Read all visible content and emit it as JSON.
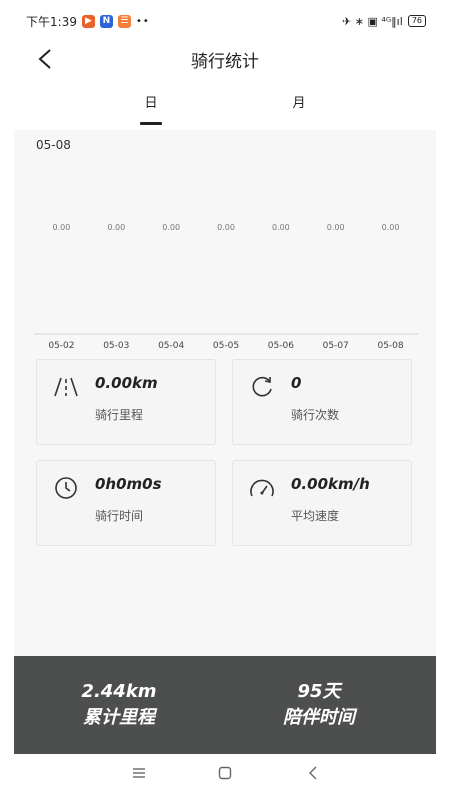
{
  "status_bar": {
    "time": "下午1:39",
    "notif_icons": [
      {
        "name": "app-notification-icon",
        "color": "#e8622a",
        "glyph": "▶"
      },
      {
        "name": "n-notification-icon",
        "color": "#2a66d9",
        "glyph": "N"
      },
      {
        "name": "app2-notification-icon",
        "color": "#f0803c",
        "glyph": "☰"
      }
    ],
    "dots": "••",
    "right_text": "✈ ∗ ▣ ⁴ᴳ‖ıl",
    "battery": "76"
  },
  "header": {
    "title": "骑行统计"
  },
  "tabs": [
    {
      "label": "日",
      "active": true
    },
    {
      "label": "月",
      "active": false
    }
  ],
  "selected_date": "05-08",
  "chart_data": {
    "type": "bar",
    "categories": [
      "05-02",
      "05-03",
      "05-04",
      "05-05",
      "05-06",
      "05-07",
      "05-08"
    ],
    "values": [
      0,
      0,
      0,
      0,
      0,
      0,
      0
    ],
    "value_labels": [
      "0.00",
      "0.00",
      "0.00",
      "0.00",
      "0.00",
      "0.00",
      "0.00"
    ],
    "title": "",
    "xlabel": "",
    "ylabel": "",
    "grid": false
  },
  "stats": [
    {
      "icon": "road-icon",
      "value": "0.00km",
      "label": "骑行里程"
    },
    {
      "icon": "refresh-icon",
      "value": "0",
      "label": "骑行次数"
    },
    {
      "icon": "clock-icon",
      "value": "0h0m0s",
      "label": "骑行时间"
    },
    {
      "icon": "speedometer-icon",
      "value": "0.00km/h",
      "label": "平均速度"
    }
  ],
  "summary": {
    "total_distance_value": "2.44km",
    "total_distance_label": "累计里程",
    "companion_days_value": "95天",
    "companion_days_label": "陪伴时间"
  },
  "colors": {
    "summary_bg": "#4d4e4e",
    "page_bg": "#f6f7f6"
  }
}
